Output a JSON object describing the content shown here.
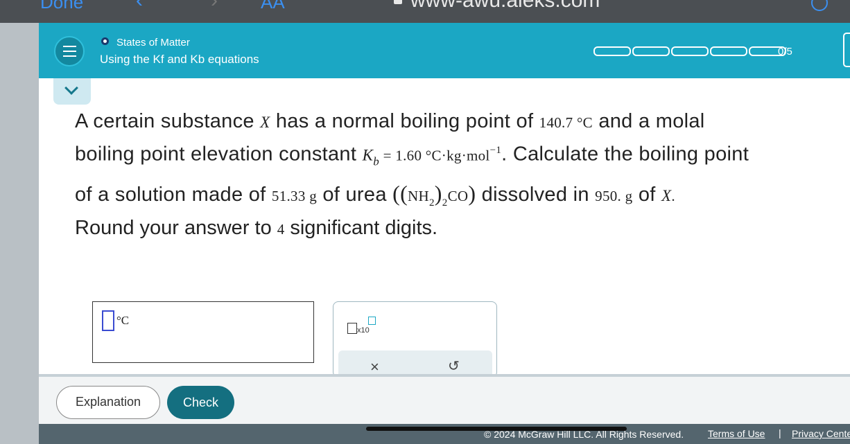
{
  "browser": {
    "done_label": "Done",
    "text_size_label": "AA",
    "url": "www-awu.aleks.com"
  },
  "topic": {
    "section": "States of Matter",
    "title": "Using the Kf and Kb equations",
    "progress_label": "0/5",
    "progress_segments": 5,
    "progress_value": 0
  },
  "question": {
    "line1_a": "A certain substance ",
    "var_x": "X",
    "line1_b": " has a normal boiling point of ",
    "boiling_point": "140.7 °C",
    "line1_c": " and a molal",
    "line2_a": "boiling point elevation constant ",
    "kb_symbol": "K",
    "kb_sub": "b",
    "kb_value": " = 1.60 °C·kg·mol",
    "kb_exp": "−1",
    "line2_b": ". Calculate the boiling point",
    "line3_a": "of a solution made of ",
    "mass_urea": "51.33 g",
    "line3_b": " of urea ",
    "formula_nh": "NH",
    "formula_sub2a": "2",
    "formula_sub2b": "2",
    "formula_co": "CO",
    "line3_c": " dissolved in ",
    "mass_solvent": "950. g",
    "line3_d": " of ",
    "line3_end": ".",
    "round_a": "Round your answer to ",
    "sig_digits": "4",
    "round_b": " significant digits."
  },
  "answer": {
    "unit": "°C",
    "value": ""
  },
  "tools": {
    "sci_multiplier": "x10",
    "clear_symbol": "×",
    "undo_symbol": "↺"
  },
  "actions": {
    "explanation_label": "Explanation",
    "check_label": "Check"
  },
  "footer": {
    "copyright": "© 2024 McGraw Hill LLC. All Rights Reserved.",
    "terms_label": "Terms of Use",
    "separator": "|",
    "privacy_label": "Privacy Center"
  },
  "colors": {
    "topic_bar": "#1ba7c4",
    "check_button": "#146f80",
    "answer_slot_border": "#3a4bd1",
    "footer": "#54656e"
  }
}
